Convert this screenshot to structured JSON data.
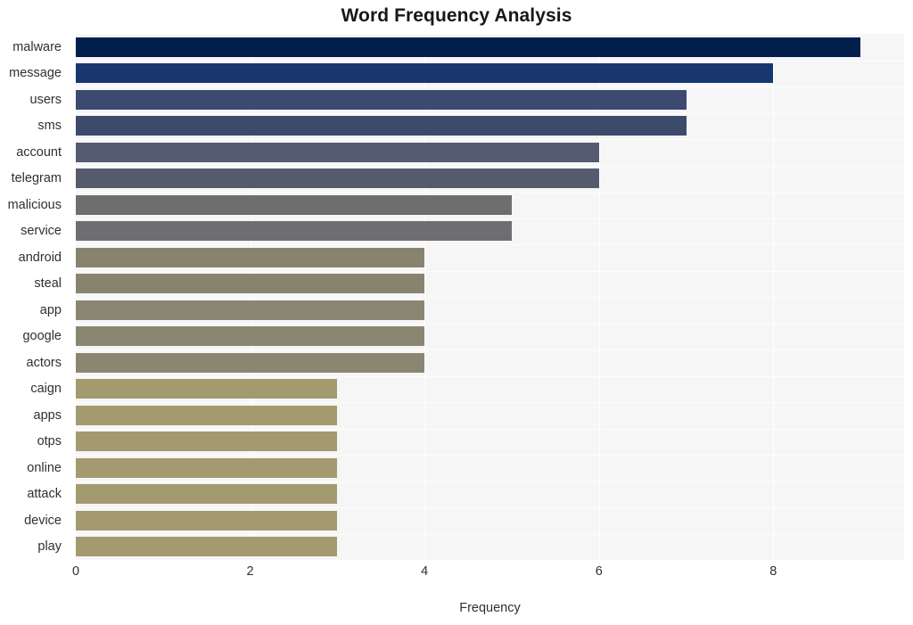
{
  "chart_data": {
    "type": "bar",
    "orientation": "horizontal",
    "title": "Word Frequency Analysis",
    "xlabel": "Frequency",
    "ylabel": "",
    "categories": [
      "malware",
      "message",
      "users",
      "sms",
      "account",
      "telegram",
      "malicious",
      "service",
      "android",
      "steal",
      "app",
      "google",
      "actors",
      "caign",
      "apps",
      "otps",
      "online",
      "attack",
      "device",
      "play"
    ],
    "values": [
      9,
      8,
      7,
      7,
      6,
      6,
      5,
      5,
      4,
      4,
      4,
      4,
      4,
      3,
      3,
      3,
      3,
      3,
      3,
      3
    ],
    "bar_colors": [
      "#03204c",
      "#183670",
      "#3c4a72",
      "#3c4b6c",
      "#555b70",
      "#555b6d",
      "#6e6e71",
      "#6e6e71",
      "#87836f",
      "#87836f",
      "#8a8672",
      "#8a8672",
      "#8a8672",
      "#a39a6f",
      "#a39a6f",
      "#a39a6f",
      "#a39a6f",
      "#a39a6f",
      "#a39a6f",
      "#a39a6f"
    ],
    "xlim": [
      0,
      9.5
    ],
    "xticks": [
      0,
      2,
      4,
      6,
      8
    ],
    "xtick_labels": [
      "0",
      "2",
      "4",
      "6",
      "8"
    ],
    "grid": true,
    "grid_axis": "x",
    "legend": null,
    "plot_background": "#f6f6f7",
    "figure_background": "#ffffff",
    "gridline_color": "#ffffff",
    "text_color": "#2f3034",
    "title_color": "#17181c"
  }
}
